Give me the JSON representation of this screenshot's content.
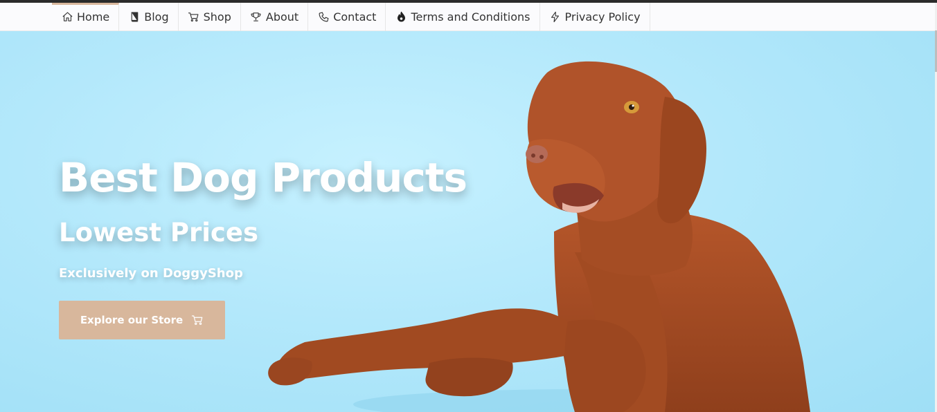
{
  "nav": {
    "items": [
      {
        "label": "Home",
        "icon": "home-icon",
        "active": true
      },
      {
        "label": "Blog",
        "icon": "book-icon",
        "active": false
      },
      {
        "label": "Shop",
        "icon": "cart-icon",
        "active": false
      },
      {
        "label": "About",
        "icon": "trophy-icon",
        "active": false
      },
      {
        "label": "Contact",
        "icon": "phone-icon",
        "active": false
      },
      {
        "label": "Terms and Conditions",
        "icon": "flame-icon",
        "active": false
      },
      {
        "label": "Privacy Policy",
        "icon": "bolt-icon",
        "active": false
      }
    ]
  },
  "hero": {
    "headline": "Best Dog Products",
    "subheadline": "Lowest Prices",
    "tagline": "Exclusively on DoggyShop",
    "cta_label": "Explore our Store",
    "cta_icon": "cart-icon",
    "image": "dog-photo"
  },
  "colors": {
    "accent": "#d8b79c",
    "hero_background": "#b3e8fb",
    "topbar": "#2b2b2b"
  }
}
